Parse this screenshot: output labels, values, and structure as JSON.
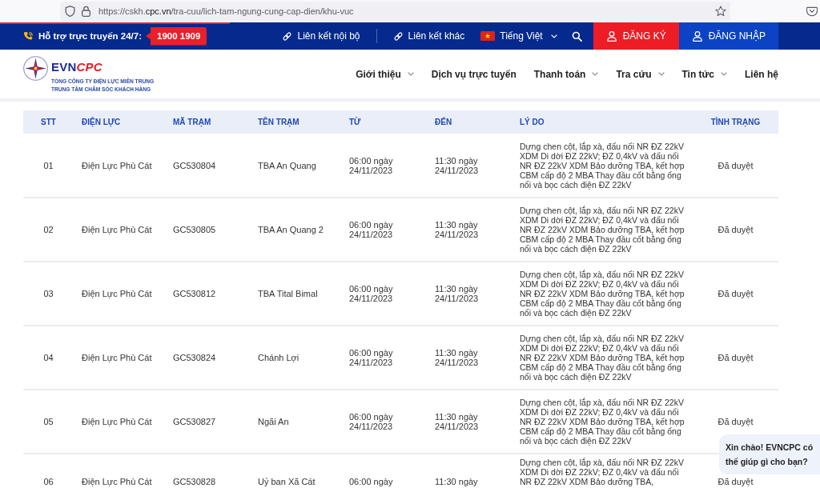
{
  "browser": {
    "url": "https://cskh.**cpc.vn**/tra-cuu/lich-tam-ngung-cung-cap-dien/khu-vuc"
  },
  "loading": {
    "level": 0.28
  },
  "topbar": {
    "support_label": "Hỗ trợ trực truyến 24/7:",
    "hotline": "1900 1909",
    "links": [
      {
        "label": "Liên kết nội bộ"
      },
      {
        "label": "Liên kết khác"
      }
    ],
    "language": "Tiếng Việt",
    "buttons": [
      {
        "label": "ĐĂNG KÝ",
        "kind": "register"
      },
      {
        "label": "ĐĂNG NHẬP",
        "kind": "login"
      }
    ]
  },
  "header": {
    "logo": {
      "wordmark": {
        "main": "EVN",
        "accent": "CPC"
      },
      "subtitle": [
        "TỔNG CÔNG TY ĐIỆN LỰC MIỀN TRUNG",
        "TRUNG TÂM CHĂM SÓC KHÁCH HÀNG"
      ]
    },
    "nav": [
      {
        "label": "Giới thiệu",
        "dropdown": true
      },
      {
        "label": "Dịch vụ trực tuyến",
        "dropdown": false
      },
      {
        "label": "Thanh toán",
        "dropdown": true
      },
      {
        "label": "Tra cứu",
        "dropdown": true
      },
      {
        "label": "Tin tức",
        "dropdown": true
      },
      {
        "label": "Liên hệ",
        "dropdown": false
      }
    ]
  },
  "table": {
    "columns": [
      "STT",
      "ĐIỆN LỰC",
      "MÃ TRẠM",
      "TÊN TRẠM",
      "TỪ",
      "ĐẾN",
      "LÝ DO",
      "TÌNH TRẠNG"
    ],
    "rows": [
      {
        "cells": [
          "01",
          "Điện Lực Phù Cát",
          "GC530804",
          "TBA An Quang",
          "06:00 ngày 24/11/2023",
          "11:30 ngày 24/11/2023",
          "Dựng chen cột, lắp xà, đấu nối NR ĐZ 22kV XDM Di dời ĐZ 22kV; ĐZ 0,4kV và đấu nối NR ĐZ 22kV XDM Bảo dưỡng TBA, kết hợp CBM cấp độ 2 MBA Thay đầu cốt bằng ống nối và bọc cách điện ĐZ 22kV",
          "Đã duyệt"
        ]
      },
      {
        "cells": [
          "02",
          "Điện Lực Phù Cát",
          "GC530805",
          "TBA An Quang 2",
          "06:00 ngày 24/11/2023",
          "11:30 ngày 24/11/2023",
          "Dựng chen cột, lắp xà, đấu nối NR ĐZ 22kV XDM Di dời ĐZ 22kV; ĐZ 0,4kV và đấu nối NR ĐZ 22kV XDM Bảo dưỡng TBA, kết hợp CBM cấp độ 2 MBA Thay đầu cốt bằng ống nối và bọc cách điện ĐZ 22kV",
          "Đã duyệt"
        ]
      },
      {
        "cells": [
          "03",
          "Điện Lực Phù Cát",
          "GC530812",
          "TBA Tital Bimal",
          "06:00 ngày 24/11/2023",
          "11:30 ngày 24/11/2023",
          "Dựng chen cột, lắp xà, đấu nối NR ĐZ 22kV XDM Di dời ĐZ 22kV; ĐZ 0,4kV và đấu nối NR ĐZ 22kV XDM Bảo dưỡng TBA, kết hợp CBM cấp độ 2 MBA Thay đầu cốt bằng ống nối và bọc cách điện ĐZ 22kV",
          "Đã duyệt"
        ]
      },
      {
        "cells": [
          "04",
          "Điện Lực Phù Cát",
          "GC530824",
          "Chánh Lợi",
          "06:00 ngày 24/11/2023",
          "11:30 ngày 24/11/2023",
          "Dựng chen cột, lắp xà, đấu nối NR ĐZ 22kV XDM Di dời ĐZ 22kV; ĐZ 0,4kV và đấu nối NR ĐZ 22kV XDM Bảo dưỡng TBA, kết hợp CBM cấp độ 2 MBA Thay đầu cốt bằng ống nối và bọc cách điện ĐZ 22kV",
          "Đã duyệt"
        ]
      },
      {
        "cells": [
          "05",
          "Điện Lực Phù Cát",
          "GC530827",
          "Ngãi An",
          "06:00 ngày 24/11/2023",
          "11:30 ngày 24/11/2023",
          "Dựng chen cột, lắp xà, đấu nối NR ĐZ 22kV XDM Di dời ĐZ 22kV; ĐZ 0,4kV và đấu nối NR ĐZ 22kV XDM Bảo dưỡng TBA, kết hợp CBM cấp độ 2 MBA Thay đầu cốt bằng ống nối và bọc cách điện ĐZ 22kV",
          "Đã duyệt"
        ]
      },
      {
        "cells": [
          "06",
          "Điện Lực Phù Cát",
          "GC530828",
          "Uỷ ban Xã Cát",
          "06:00 ngày",
          "11:30 ngày",
          "Dựng chen cột, lắp xà, đấu nối NR ĐZ 22kV XDM Di dời ĐZ 22kV; ĐZ 0,4kV và đấu nối NR ĐZ 22kV XDM Bảo dưỡng TBA,",
          "Đã duyệt"
        ]
      }
    ]
  },
  "chat_bubble": {
    "text": "Xin chào! EVNCPC có thế giúp gì cho bạn?"
  }
}
